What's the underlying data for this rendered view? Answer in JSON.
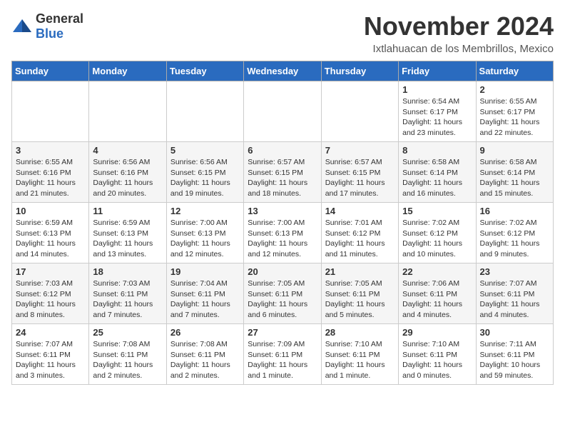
{
  "logo": {
    "general": "General",
    "blue": "Blue"
  },
  "title": "November 2024",
  "location": "Ixtlahuacan de los Membrillos, Mexico",
  "days_of_week": [
    "Sunday",
    "Monday",
    "Tuesday",
    "Wednesday",
    "Thursday",
    "Friday",
    "Saturday"
  ],
  "weeks": [
    [
      null,
      null,
      null,
      null,
      null,
      {
        "day": "1",
        "sunrise": "Sunrise: 6:54 AM",
        "sunset": "Sunset: 6:17 PM",
        "daylight": "Daylight: 11 hours and 23 minutes."
      },
      {
        "day": "2",
        "sunrise": "Sunrise: 6:55 AM",
        "sunset": "Sunset: 6:17 PM",
        "daylight": "Daylight: 11 hours and 22 minutes."
      }
    ],
    [
      {
        "day": "3",
        "sunrise": "Sunrise: 6:55 AM",
        "sunset": "Sunset: 6:16 PM",
        "daylight": "Daylight: 11 hours and 21 minutes."
      },
      {
        "day": "4",
        "sunrise": "Sunrise: 6:56 AM",
        "sunset": "Sunset: 6:16 PM",
        "daylight": "Daylight: 11 hours and 20 minutes."
      },
      {
        "day": "5",
        "sunrise": "Sunrise: 6:56 AM",
        "sunset": "Sunset: 6:15 PM",
        "daylight": "Daylight: 11 hours and 19 minutes."
      },
      {
        "day": "6",
        "sunrise": "Sunrise: 6:57 AM",
        "sunset": "Sunset: 6:15 PM",
        "daylight": "Daylight: 11 hours and 18 minutes."
      },
      {
        "day": "7",
        "sunrise": "Sunrise: 6:57 AM",
        "sunset": "Sunset: 6:15 PM",
        "daylight": "Daylight: 11 hours and 17 minutes."
      },
      {
        "day": "8",
        "sunrise": "Sunrise: 6:58 AM",
        "sunset": "Sunset: 6:14 PM",
        "daylight": "Daylight: 11 hours and 16 minutes."
      },
      {
        "day": "9",
        "sunrise": "Sunrise: 6:58 AM",
        "sunset": "Sunset: 6:14 PM",
        "daylight": "Daylight: 11 hours and 15 minutes."
      }
    ],
    [
      {
        "day": "10",
        "sunrise": "Sunrise: 6:59 AM",
        "sunset": "Sunset: 6:13 PM",
        "daylight": "Daylight: 11 hours and 14 minutes."
      },
      {
        "day": "11",
        "sunrise": "Sunrise: 6:59 AM",
        "sunset": "Sunset: 6:13 PM",
        "daylight": "Daylight: 11 hours and 13 minutes."
      },
      {
        "day": "12",
        "sunrise": "Sunrise: 7:00 AM",
        "sunset": "Sunset: 6:13 PM",
        "daylight": "Daylight: 11 hours and 12 minutes."
      },
      {
        "day": "13",
        "sunrise": "Sunrise: 7:00 AM",
        "sunset": "Sunset: 6:13 PM",
        "daylight": "Daylight: 11 hours and 12 minutes."
      },
      {
        "day": "14",
        "sunrise": "Sunrise: 7:01 AM",
        "sunset": "Sunset: 6:12 PM",
        "daylight": "Daylight: 11 hours and 11 minutes."
      },
      {
        "day": "15",
        "sunrise": "Sunrise: 7:02 AM",
        "sunset": "Sunset: 6:12 PM",
        "daylight": "Daylight: 11 hours and 10 minutes."
      },
      {
        "day": "16",
        "sunrise": "Sunrise: 7:02 AM",
        "sunset": "Sunset: 6:12 PM",
        "daylight": "Daylight: 11 hours and 9 minutes."
      }
    ],
    [
      {
        "day": "17",
        "sunrise": "Sunrise: 7:03 AM",
        "sunset": "Sunset: 6:12 PM",
        "daylight": "Daylight: 11 hours and 8 minutes."
      },
      {
        "day": "18",
        "sunrise": "Sunrise: 7:03 AM",
        "sunset": "Sunset: 6:11 PM",
        "daylight": "Daylight: 11 hours and 7 minutes."
      },
      {
        "day": "19",
        "sunrise": "Sunrise: 7:04 AM",
        "sunset": "Sunset: 6:11 PM",
        "daylight": "Daylight: 11 hours and 7 minutes."
      },
      {
        "day": "20",
        "sunrise": "Sunrise: 7:05 AM",
        "sunset": "Sunset: 6:11 PM",
        "daylight": "Daylight: 11 hours and 6 minutes."
      },
      {
        "day": "21",
        "sunrise": "Sunrise: 7:05 AM",
        "sunset": "Sunset: 6:11 PM",
        "daylight": "Daylight: 11 hours and 5 minutes."
      },
      {
        "day": "22",
        "sunrise": "Sunrise: 7:06 AM",
        "sunset": "Sunset: 6:11 PM",
        "daylight": "Daylight: 11 hours and 4 minutes."
      },
      {
        "day": "23",
        "sunrise": "Sunrise: 7:07 AM",
        "sunset": "Sunset: 6:11 PM",
        "daylight": "Daylight: 11 hours and 4 minutes."
      }
    ],
    [
      {
        "day": "24",
        "sunrise": "Sunrise: 7:07 AM",
        "sunset": "Sunset: 6:11 PM",
        "daylight": "Daylight: 11 hours and 3 minutes."
      },
      {
        "day": "25",
        "sunrise": "Sunrise: 7:08 AM",
        "sunset": "Sunset: 6:11 PM",
        "daylight": "Daylight: 11 hours and 2 minutes."
      },
      {
        "day": "26",
        "sunrise": "Sunrise: 7:08 AM",
        "sunset": "Sunset: 6:11 PM",
        "daylight": "Daylight: 11 hours and 2 minutes."
      },
      {
        "day": "27",
        "sunrise": "Sunrise: 7:09 AM",
        "sunset": "Sunset: 6:11 PM",
        "daylight": "Daylight: 11 hours and 1 minute."
      },
      {
        "day": "28",
        "sunrise": "Sunrise: 7:10 AM",
        "sunset": "Sunset: 6:11 PM",
        "daylight": "Daylight: 11 hours and 1 minute."
      },
      {
        "day": "29",
        "sunrise": "Sunrise: 7:10 AM",
        "sunset": "Sunset: 6:11 PM",
        "daylight": "Daylight: 11 hours and 0 minutes."
      },
      {
        "day": "30",
        "sunrise": "Sunrise: 7:11 AM",
        "sunset": "Sunset: 6:11 PM",
        "daylight": "Daylight: 10 hours and 59 minutes."
      }
    ]
  ]
}
